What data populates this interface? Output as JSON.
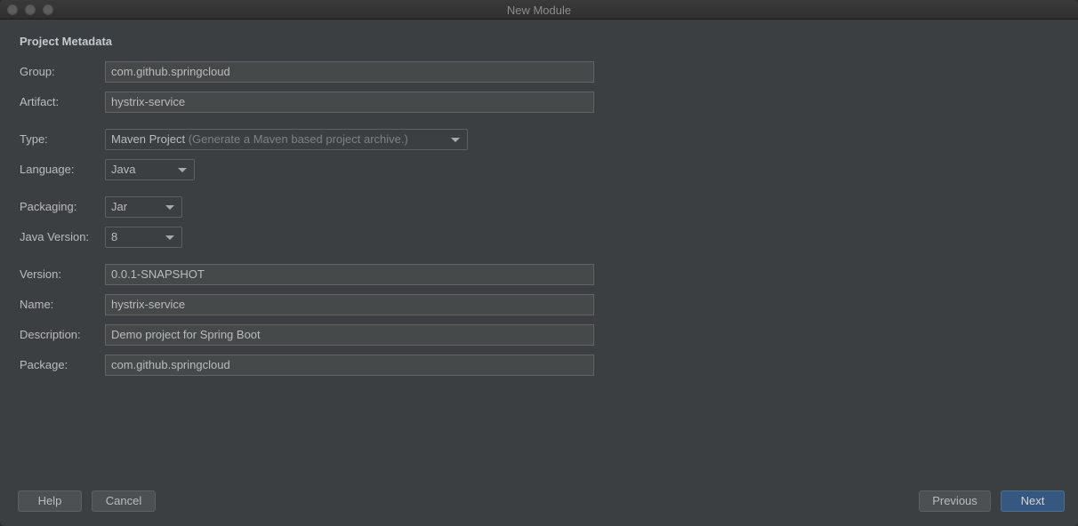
{
  "window": {
    "title": "New Module"
  },
  "section_title": "Project Metadata",
  "fields": {
    "group": {
      "label": "Group:",
      "value": "com.github.springcloud"
    },
    "artifact": {
      "label": "Artifact:",
      "value": "hystrix-service"
    },
    "type": {
      "label": "Type:",
      "value": "Maven Project",
      "hint": "(Generate a Maven based project archive.)"
    },
    "language": {
      "label": "Language:",
      "value": "Java"
    },
    "packaging": {
      "label": "Packaging:",
      "value": "Jar"
    },
    "java_version": {
      "label": "Java Version:",
      "value": "8"
    },
    "version": {
      "label": "Version:",
      "value": "0.0.1-SNAPSHOT"
    },
    "name": {
      "label": "Name:",
      "value": "hystrix-service"
    },
    "description": {
      "label": "Description:",
      "value": "Demo project for Spring Boot"
    },
    "package": {
      "label": "Package:",
      "value": "com.github.springcloud"
    }
  },
  "buttons": {
    "help": "Help",
    "cancel": "Cancel",
    "previous": "Previous",
    "next": "Next"
  },
  "colors": {
    "background": "#3c3f41",
    "field_background": "#45494a",
    "primary_button": "#365880"
  }
}
